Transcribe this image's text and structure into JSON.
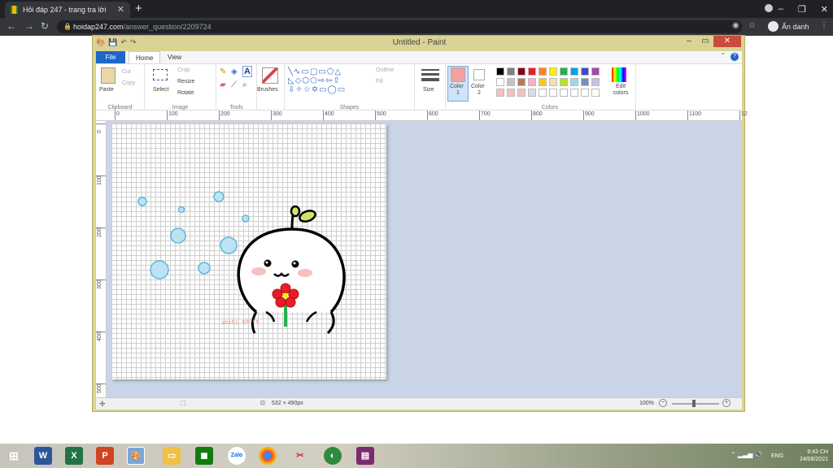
{
  "browser": {
    "tab_title": "Hỏi đáp 247 - trang tra lời",
    "tab_close": "✕",
    "new_tab": "+",
    "url_host": "hoidap247.com",
    "url_path": "/answer_question/2209724",
    "profile_label": "Ẩn danh",
    "window_controls": [
      "–",
      "❐",
      "✕"
    ]
  },
  "paint": {
    "title": "Untitled - Paint",
    "tabs": {
      "file": "File",
      "home": "Home",
      "view": "View"
    },
    "clipboard": {
      "paste": "Paste",
      "cut": "Cut",
      "copy": "Copy",
      "label": "Clipboard"
    },
    "image": {
      "select": "Select",
      "crop": "Crop",
      "resize": "Resize",
      "rotate": "Rotate",
      "label": "Image"
    },
    "tools": {
      "label": "Tools",
      "brushes": "Brushes"
    },
    "shapes": {
      "label": "Shapes",
      "outline": "Outline",
      "fill": "Fill",
      "glyphs": "╲∿▭▢▭⬠△ ◺◇⬡⬠⇨⇦⇧ ⇩✧☆✡▭◯▭"
    },
    "size": "Size",
    "color1": {
      "label": "Color",
      "num": "1",
      "value": "#f4a0a0"
    },
    "color2": {
      "label": "Color",
      "num": "2",
      "value": "#ffffff"
    },
    "colors_label": "Colors",
    "edit_colors": "Edit colors",
    "palette_row1": [
      "#000000",
      "#7f7f7f",
      "#880015",
      "#ed1c24",
      "#ff7f27",
      "#fff200",
      "#22b14c",
      "#00a2e8",
      "#3f48cc",
      "#a349a4"
    ],
    "palette_row2": [
      "#ffffff",
      "#c3c3c3",
      "#b97a57",
      "#ffaec9",
      "#ffc90e",
      "#efe4b0",
      "#b5e61d",
      "#99d9ea",
      "#7092be",
      "#c8bfe7"
    ],
    "palette_row3": [
      "#f4c2c2",
      "#f4c2c2",
      "#f4c2c2",
      "#dddddd",
      "#ffffff",
      "#ffffff",
      "#ffffff",
      "#ffffff",
      "#ffffff",
      "#ffffff"
    ],
    "ruler_h": [
      "0",
      "100",
      "200",
      "300",
      "400",
      "500",
      "600",
      "700",
      "800",
      "900",
      "1000",
      "1100",
      "12"
    ],
    "ruler_v": [
      "0",
      "100",
      "200",
      "300",
      "400",
      "500"
    ],
    "canvas_size": "532 × 490px",
    "zoom": "100%",
    "status_minus": "−",
    "status_plus": "+",
    "text_on_canvas": "ahihi sorry"
  },
  "taskbar": {
    "apps": [
      "windows",
      "word",
      "excel",
      "powerpoint",
      "paint",
      "explorer",
      "store",
      "zalo",
      "chrome",
      "snipping",
      "greenshot",
      "rar"
    ],
    "lang": "ENG",
    "time": "9:43 CH",
    "date": "24/08/2021"
  }
}
